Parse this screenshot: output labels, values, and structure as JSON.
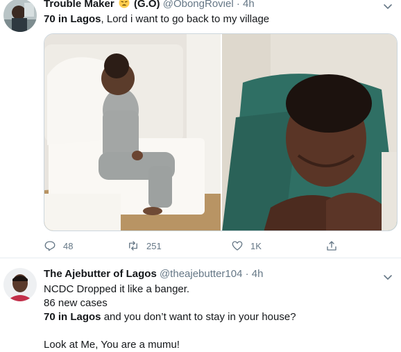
{
  "tweets": [
    {
      "display_name": "Trouble Maker",
      "name_suffix": "(G.O)",
      "handle": "@ObongRoviel",
      "dot": "·",
      "time": "4h",
      "lines": [
        [
          {
            "text": "70 in Lagos",
            "bold": true
          },
          {
            "text": ", Lord i want to go back to my village",
            "bold": false
          }
        ]
      ],
      "actions": {
        "reply_count": "48",
        "retweet_count": "251",
        "like_count": "1K"
      }
    },
    {
      "display_name": "The Ajebutter of Lagos",
      "handle": "@theajebutter104",
      "dot": "·",
      "time": "4h",
      "lines": [
        [
          {
            "text": "NCDC Dropped it like a banger.",
            "bold": false
          }
        ],
        [
          {
            "text": "86 new cases",
            "bold": false
          }
        ],
        [
          {
            "text": "70 in Lagos",
            "bold": true
          },
          {
            "text": " and you don’t want to stay in your house?",
            "bold": false
          }
        ],
        [],
        [
          {
            "text": "Look at Me, You are a mumu!",
            "bold": false
          }
        ]
      ]
    }
  ],
  "icons": {
    "reply": "reply-icon",
    "retweet": "retweet-icon",
    "like": "heart-icon",
    "share": "share-icon",
    "more": "chevron-down-icon",
    "emoji": "weary-face-emoji-icon"
  },
  "colors": {
    "text": "#14171a",
    "secondary": "#657786",
    "divider": "#e6ecf0"
  }
}
